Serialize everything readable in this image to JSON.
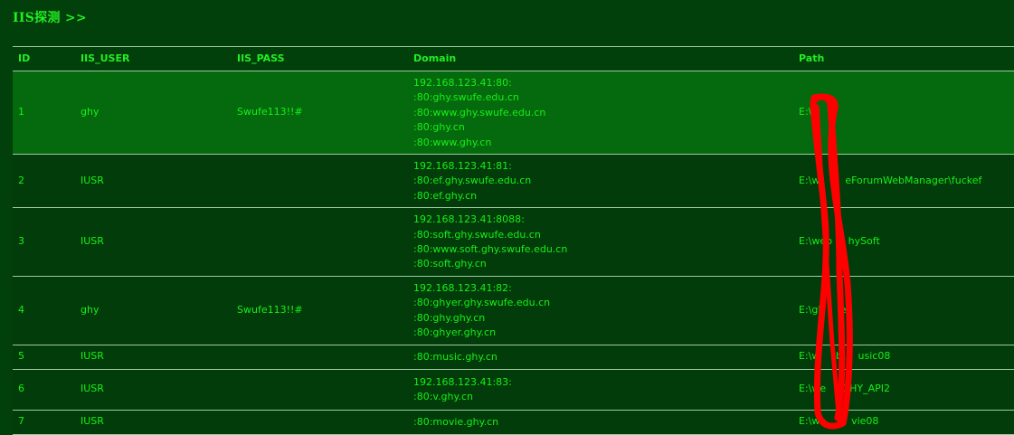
{
  "page": {
    "title": "IIS探测 >>"
  },
  "table": {
    "headers": {
      "id": "ID",
      "user": "IIS_USER",
      "pass": "IIS_PASS",
      "domain": "Domain",
      "path": "Path"
    },
    "rows": [
      {
        "id": "1",
        "user": "ghy",
        "pass": "Swufe113!!#",
        "domains": [
          "192.168.123.41:80:",
          ":80:ghy.swufe.edu.cn",
          ":80:www.ghy.swufe.edu.cn",
          ":80:ghy.cn",
          ":80:www.ghy.cn"
        ],
        "path": "E:\\w",
        "highlighted": true
      },
      {
        "id": "2",
        "user": "IUSR",
        "pass": "",
        "domains": [
          "192.168.123.41:81:",
          ":80:ef.ghy.swufe.edu.cn",
          ":80:ef.ghy.cn"
        ],
        "path": "E:\\w        eForumWebManager\\fuckef"
      },
      {
        "id": "3",
        "user": "IUSR",
        "pass": "",
        "domains": [
          "192.168.123.41:8088:",
          ":80:soft.ghy.swufe.edu.cn",
          ":80:www.soft.ghy.swufe.edu.cn",
          ":80:soft.ghy.cn"
        ],
        "path": "E:\\web     hySoft"
      },
      {
        "id": "4",
        "user": "ghy",
        "pass": "Swufe113!!#",
        "domains": [
          "192.168.123.41:82:",
          ":80:ghyer.ghy.swufe.edu.cn",
          ":80:ghy.ghy.cn",
          ":80:ghyer.ghy.cn"
        ],
        "path": "E:\\gh     er"
      },
      {
        "id": "5",
        "user": "IUSR",
        "pass": "",
        "domains": [
          ":80:music.ghy.cn"
        ],
        "path": "E:\\w     b\\    usic08"
      },
      {
        "id": "6",
        "user": "IUSR",
        "pass": "",
        "domains": [
          "192.168.123.41:83:",
          ":80:v.ghy.cn"
        ],
        "path": "E:\\we     GHY_API2"
      },
      {
        "id": "7",
        "user": "IUSR",
        "pass": "",
        "domains": [
          ":80:movie.ghy.cn"
        ],
        "path": "E:\\we        vie08"
      }
    ]
  },
  "colors": {
    "background": "#013f0b",
    "highlight_row": "#056a0e",
    "text": "#16f016",
    "scribble": "#ff0000"
  }
}
